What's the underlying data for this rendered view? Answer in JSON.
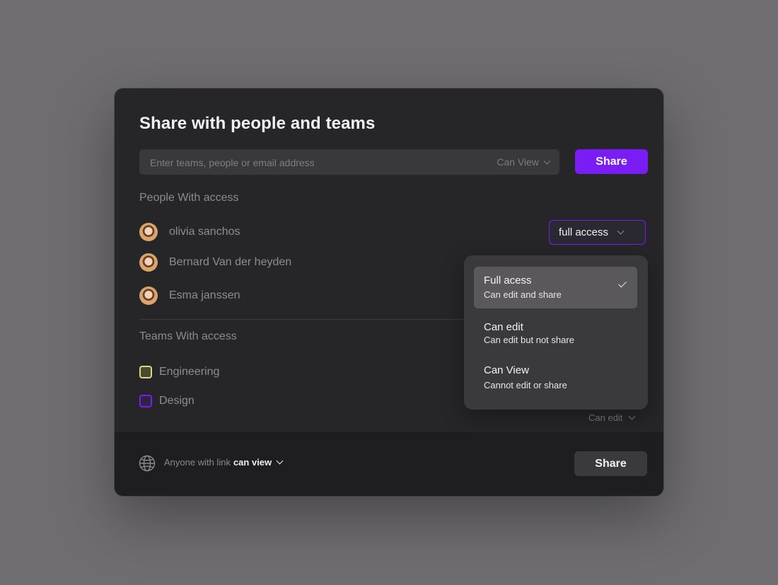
{
  "dialog": {
    "title": "Share with people and teams",
    "search": {
      "placeholder": "Enter teams, people or email address",
      "permission": "Can View"
    },
    "share_button": "Share",
    "people_section_title": "People With access",
    "people": [
      {
        "name": "olivia sanchos",
        "access": "full access"
      },
      {
        "name": "Bernard Van der heyden"
      },
      {
        "name": "Esma janssen"
      }
    ],
    "teams_section_title": "Teams With access",
    "teams": [
      {
        "name": "Engineering",
        "color": "#d8d98a"
      },
      {
        "name": "Design",
        "color": "#7a1df5"
      }
    ],
    "team_permission": "Can edit",
    "access_menu": [
      {
        "title": "Full acess",
        "subtitle": "Can edit and share",
        "selected": true
      },
      {
        "title": "Can edit",
        "subtitle": "Can edit but not share",
        "selected": false
      },
      {
        "title": "Can View",
        "subtitle": "Cannot edit or share",
        "selected": false
      }
    ],
    "footer": {
      "link_prefix": "Anyone with link",
      "link_permission": "can view",
      "share_button": "Share"
    }
  },
  "colors": {
    "accent": "#7a1df5",
    "background": "#6f6d72",
    "panel": "#262528",
    "footer": "#1e1d20"
  }
}
